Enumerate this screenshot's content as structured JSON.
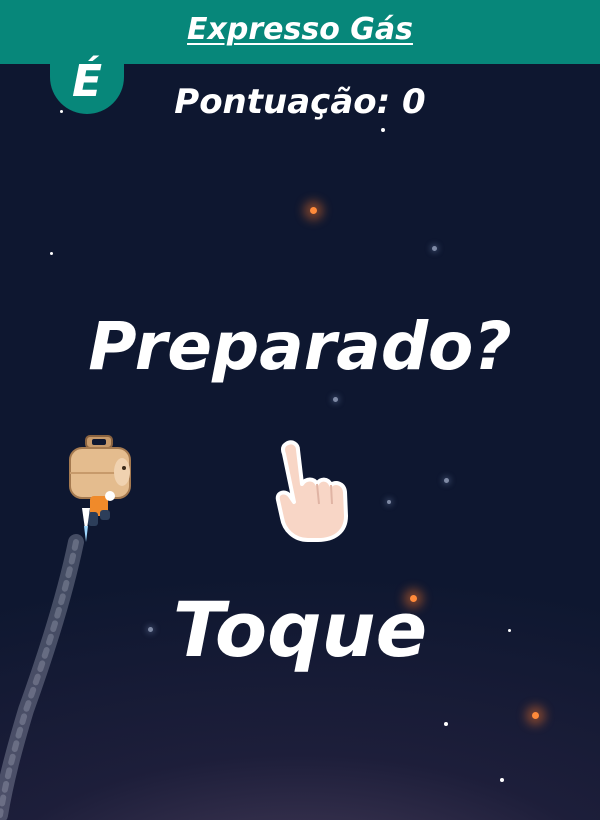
{
  "header": {
    "brand_title": "Expresso Gás",
    "logo_letter": "É"
  },
  "hud": {
    "score_text": "Pontuação: 0"
  },
  "prompt": {
    "ready_text": "Preparado?",
    "tap_text": "Toque"
  },
  "colors": {
    "header_bg": "#07877a",
    "sky_top": "#0e1730",
    "glow_star": "#ff8a3a",
    "text": "#ffffff"
  },
  "icons": {
    "tap_hand": "pointing-hand-icon",
    "player": "gas-cylinder-jetpack-character"
  }
}
